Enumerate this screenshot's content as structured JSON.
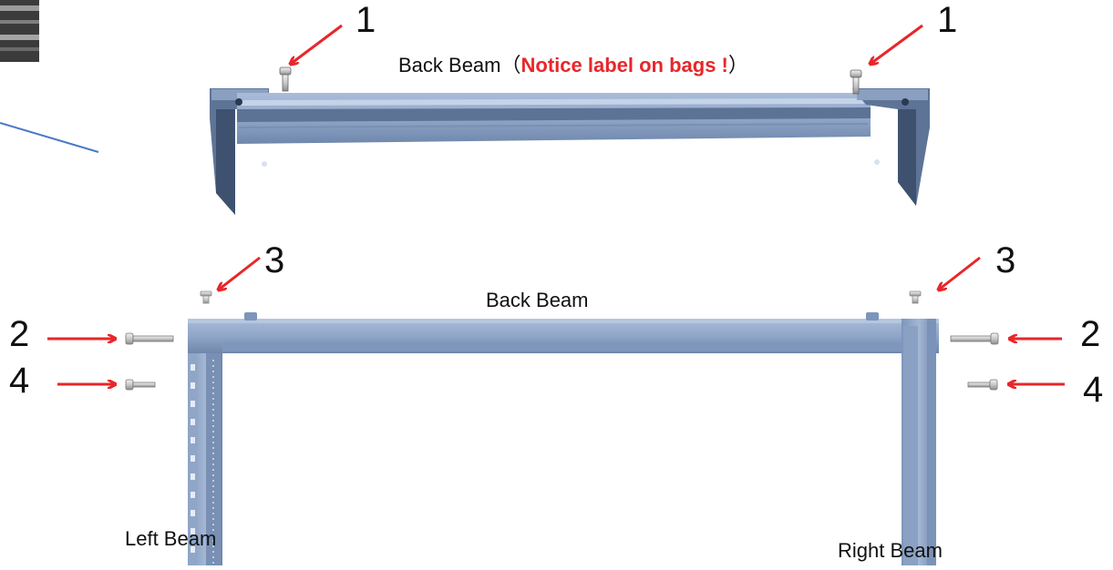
{
  "labels": {
    "top_title_prefix": "Back Beam（",
    "top_title_notice": "Notice label on bags !",
    "top_title_suffix": "）",
    "back_beam": "Back Beam",
    "left_beam": "Left Beam",
    "right_beam": "Right Beam"
  },
  "numbers": {
    "one_left": "1",
    "one_right": "1",
    "two_left": "2",
    "two_right": "2",
    "three_left": "3",
    "three_right": "3",
    "four_left": "4",
    "four_right": "4"
  },
  "colors": {
    "arrow": "#e8262a",
    "beam_fill": "#8fa6c8",
    "beam_dark": "#5d7699",
    "guide_line": "#4a78c8",
    "notice_text": "#e8262a"
  },
  "icons": [
    "red-arrow-icon",
    "bolt-icon",
    "screw-icon",
    "rack-beam-icon"
  ]
}
